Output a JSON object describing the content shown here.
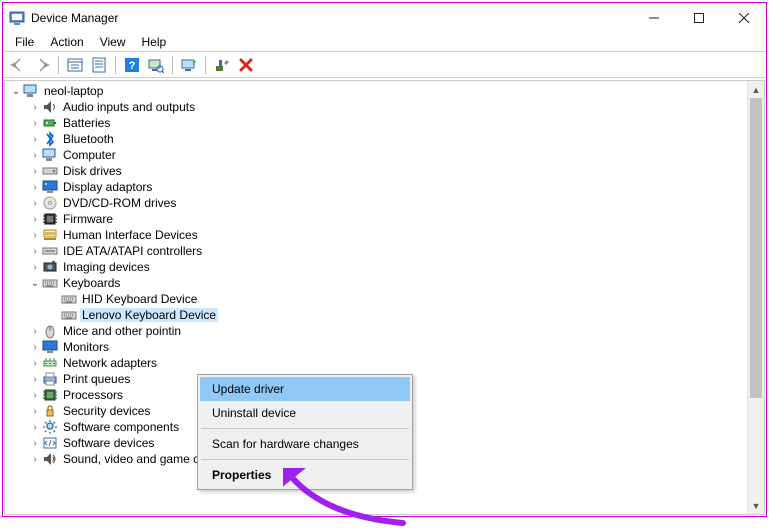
{
  "window": {
    "title": "Device Manager"
  },
  "menus": [
    "File",
    "Action",
    "View",
    "Help"
  ],
  "root": {
    "label": "neol-laptop"
  },
  "categories": [
    {
      "label": "Audio inputs and outputs",
      "icon": "speaker"
    },
    {
      "label": "Batteries",
      "icon": "battery"
    },
    {
      "label": "Bluetooth",
      "icon": "bluetooth"
    },
    {
      "label": "Computer",
      "icon": "computer"
    },
    {
      "label": "Disk drives",
      "icon": "disk"
    },
    {
      "label": "Display adaptors",
      "icon": "display"
    },
    {
      "label": "DVD/CD-ROM drives",
      "icon": "dvd"
    },
    {
      "label": "Firmware",
      "icon": "firmware"
    },
    {
      "label": "Human Interface Devices",
      "icon": "hid"
    },
    {
      "label": "IDE ATA/ATAPI controllers",
      "icon": "ide"
    },
    {
      "label": "Imaging devices",
      "icon": "imaging"
    },
    {
      "label": "Keyboards",
      "icon": "keyboard",
      "expanded": true,
      "children": [
        {
          "label": "HID Keyboard Device"
        },
        {
          "label": "Lenovo Keyboard Device",
          "selected": true
        }
      ]
    },
    {
      "label": "Mice and other pointing devices",
      "icon": "mouse",
      "truncated": true
    },
    {
      "label": "Monitors",
      "icon": "monitor"
    },
    {
      "label": "Network adapters",
      "icon": "network"
    },
    {
      "label": "Print queues",
      "icon": "printer"
    },
    {
      "label": "Processors",
      "icon": "processor"
    },
    {
      "label": "Security devices",
      "icon": "security"
    },
    {
      "label": "Software components",
      "icon": "swcomp"
    },
    {
      "label": "Software devices",
      "icon": "swdev"
    },
    {
      "label": "Sound, video and game controllers",
      "icon": "sound"
    }
  ],
  "context_menu": {
    "update": "Update driver",
    "uninstall": "Uninstall device",
    "scan": "Scan for hardware changes",
    "properties": "Properties"
  },
  "annotation": {
    "arrow_color": "#a020f0"
  }
}
